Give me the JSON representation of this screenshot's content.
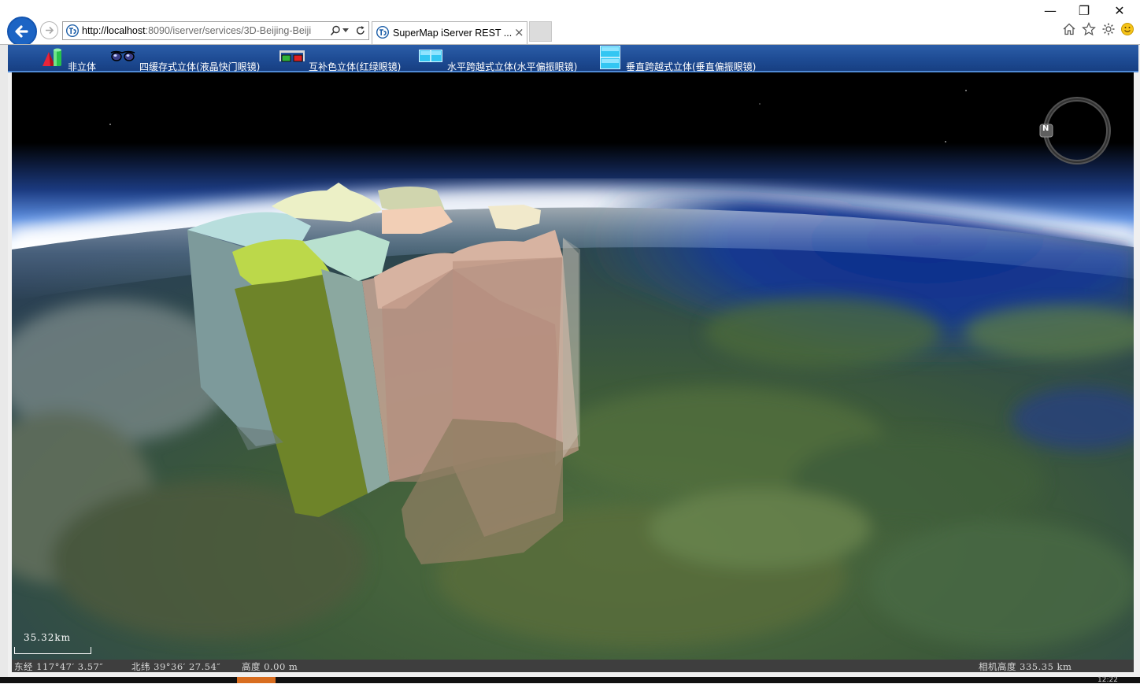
{
  "browser": {
    "url_host": "http://localhost",
    "url_rest": ":8090/iserver/services/3D-Beijing-Beiji",
    "tab_title": "SuperMap iServer REST ...",
    "tab_close": "×",
    "window_controls": [
      "—",
      "❐",
      "✕"
    ],
    "icons": [
      "back-arrow-icon",
      "forward-arrow-icon",
      "search-icon",
      "dropdown-icon",
      "refresh-icon",
      "home-icon",
      "favorites-star-icon",
      "settings-gear-icon",
      "smiley-feedback-icon"
    ]
  },
  "toolbar": {
    "items": [
      {
        "label": "非立体",
        "icon": "shapes-3d-icon"
      },
      {
        "label": "四缓存式立体(液晶快门眼镜)",
        "icon": "shutter-glasses-icon"
      },
      {
        "label": "互补色立体(红绿眼镜)",
        "icon": "red-green-glasses-icon"
      },
      {
        "label": "水平跨越式立体(水平偏振眼镜)",
        "icon": "horizontal-split-icon"
      },
      {
        "label": "垂直跨越式立体(垂直偏振眼镜)",
        "icon": "vertical-split-icon"
      }
    ]
  },
  "scene": {
    "compass_label": "N",
    "scale_label": "35.32km"
  },
  "status": {
    "longitude": "东经 117°47′ 3.57″",
    "latitude": "北纬 39°36′ 27.54″",
    "altitude": "高度 0.00 m",
    "camera_height": "相机高度 335.35 km"
  },
  "taskbar": {
    "clock": "12:22"
  }
}
